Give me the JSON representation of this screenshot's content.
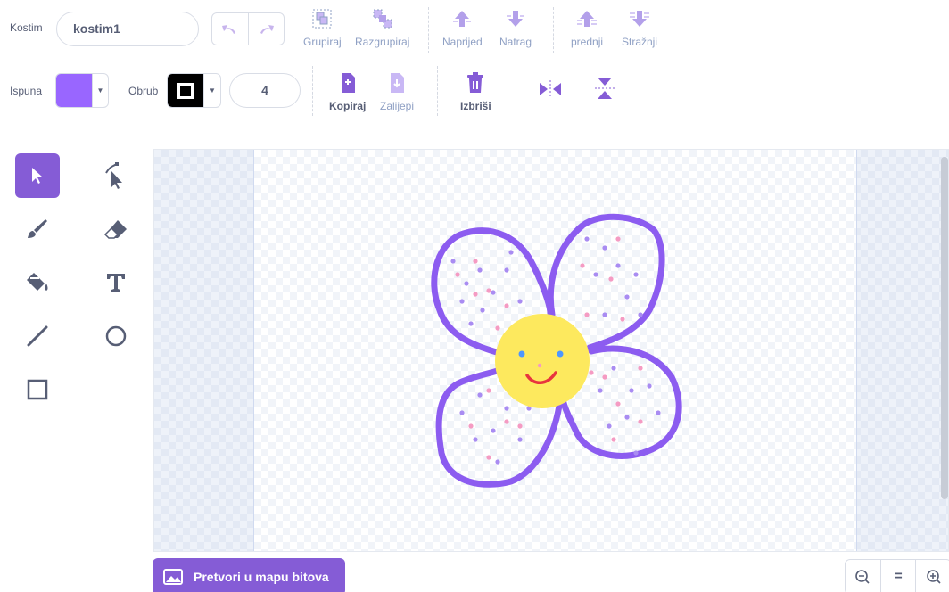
{
  "costume": {
    "label": "Kostim",
    "name_value": "kostim1"
  },
  "toolbar": {
    "group": "Grupiraj",
    "ungroup": "Razgrupiraj",
    "forward": "Naprijed",
    "backward": "Natrag",
    "front": "prednji",
    "back": "Stražnji",
    "copy": "Kopiraj",
    "paste": "Zalijepi",
    "delete": "Izbriši"
  },
  "fill": {
    "label": "Ispuna",
    "color": "#9966ff"
  },
  "outline": {
    "label": "Obrub",
    "color": "#000000",
    "width": "4"
  },
  "tools": [
    "select",
    "reshape",
    "brush",
    "eraser",
    "fill",
    "text",
    "line",
    "circle",
    "rectangle"
  ],
  "selected_tool": "select",
  "bitmap_button": {
    "label": "Pretvori u mapu bitova"
  },
  "zoom": {
    "out": "−",
    "reset": "=",
    "in": "+"
  },
  "colors": {
    "accent": "#855cd6",
    "petal_outline": "#8c5cf0",
    "flower_center": "#fde95e",
    "dot_purple": "#a98cf2",
    "dot_pink": "#f59bc3",
    "smile": "#e8343e",
    "eye": "#4d97ff"
  }
}
